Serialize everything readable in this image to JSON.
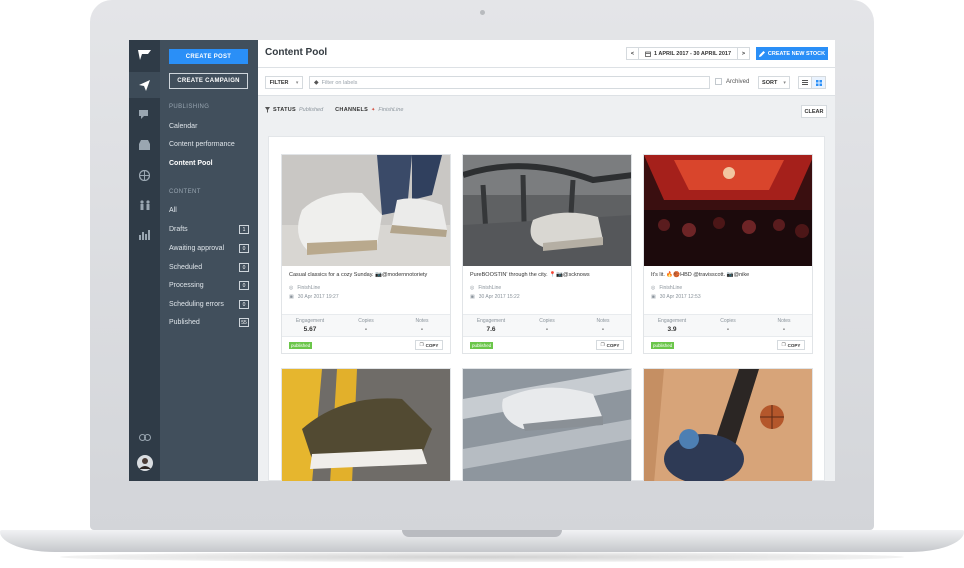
{
  "sidebar": {
    "create_post": "CREATE POST",
    "create_campaign": "CREATE CAMPAIGN",
    "publishing_heading": "PUBLISHING",
    "publishing_items": [
      {
        "label": "Calendar"
      },
      {
        "label": "Content performance"
      },
      {
        "label": "Content Pool",
        "active": true
      }
    ],
    "content_heading": "CONTENT",
    "content_items": [
      {
        "label": "All",
        "count": ""
      },
      {
        "label": "Drafts",
        "count": "1"
      },
      {
        "label": "Awaiting approval",
        "count": "0"
      },
      {
        "label": "Scheduled",
        "count": "0"
      },
      {
        "label": "Processing",
        "count": "0"
      },
      {
        "label": "Scheduling errors",
        "count": "0"
      },
      {
        "label": "Published",
        "count": "55"
      }
    ]
  },
  "rail": {
    "icons": [
      "logo-icon",
      "send-icon",
      "chat-icon",
      "inbox-icon",
      "globe-icon",
      "users-icon",
      "bar-chart-icon",
      "link-icon",
      "avatar"
    ]
  },
  "header": {
    "title": "Content Pool",
    "date_range": "1 APRIL 2017 - 30 APRIL 2017",
    "prev": "<",
    "next": ">",
    "new_stock": "CREATE NEW STOCK"
  },
  "filters": {
    "filter_label": "FILTER",
    "label_placeholder": "Filter on labels",
    "archived_label": "Archived",
    "sort_label": "SORT",
    "status_key": "STATUS",
    "status_value": "Published",
    "channels_key": "CHANNELS",
    "channels_value": "FinishLine",
    "clear_label": "CLEAR"
  },
  "cards": [
    {
      "caption": "Casual classics for a cozy Sunday. 📷@modernnotoriety",
      "account": "FinishLine",
      "date": "30 Apr 2017 19:27",
      "engagement": "5.67",
      "copies": "-",
      "notes": "-",
      "status": "published",
      "image": "sneakers-walking"
    },
    {
      "caption": "PureBOOSTIN' through the city. 📍📷@scknows",
      "account": "FinishLine",
      "date": "30 Apr 2017 15:22",
      "engagement": "7.6",
      "copies": "-",
      "notes": "-",
      "status": "published",
      "image": "sneaker-railing"
    },
    {
      "caption": "It's lit. 🔥🏀HBD @travisscott. 📷@nike",
      "account": "FinishLine",
      "date": "30 Apr 2017 12:53",
      "engagement": "3.9",
      "copies": "-",
      "notes": "-",
      "status": "published",
      "image": "concert"
    },
    {
      "image": "sneaker-road"
    },
    {
      "image": "sneaker-rail"
    },
    {
      "image": "basketball"
    }
  ],
  "stat_labels": {
    "engagement": "Engagement",
    "copies": "Copies",
    "notes": "Notes"
  },
  "copy_label": "COPY",
  "colors": {
    "accent": "#2a8ff7",
    "rail": "#2f3b47",
    "sidebar": "#414f5c",
    "published": "#6bc64a"
  }
}
